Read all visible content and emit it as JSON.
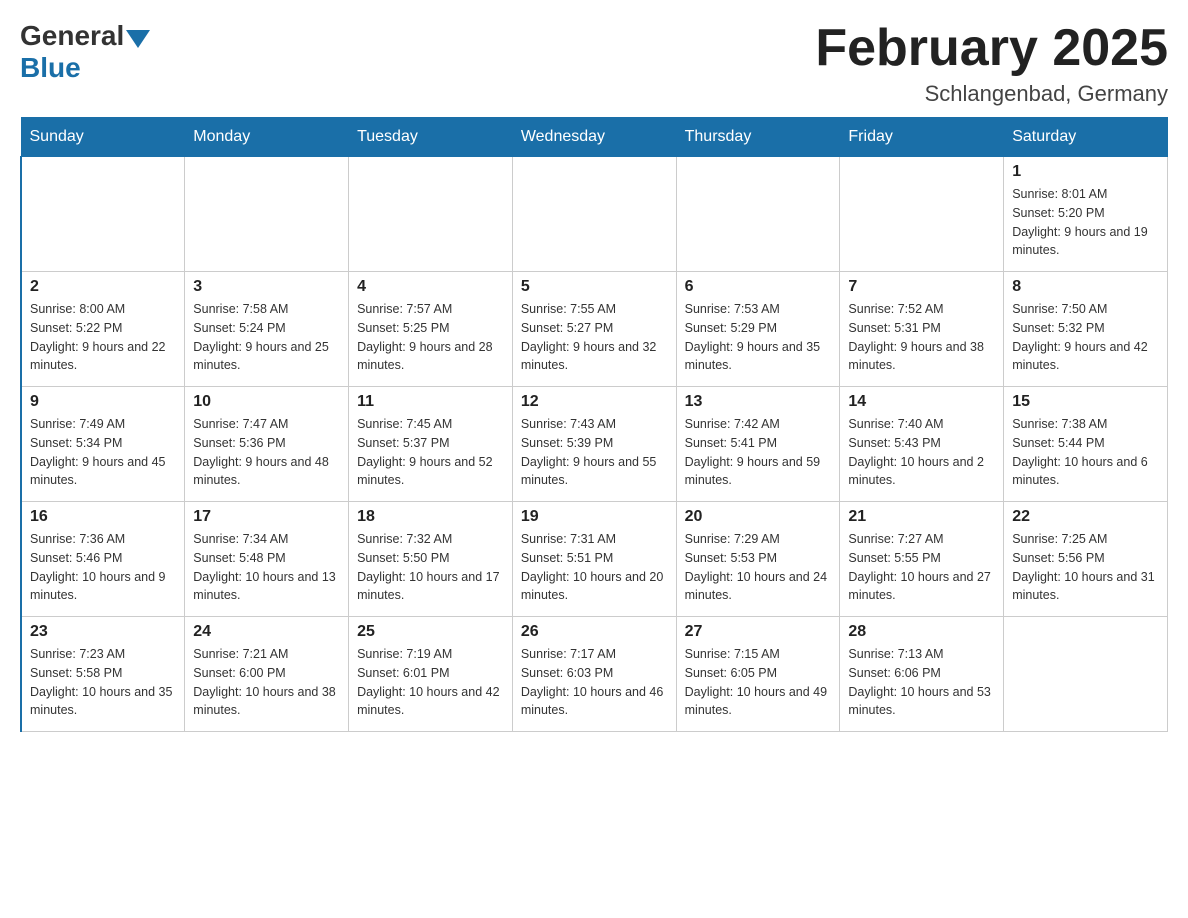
{
  "header": {
    "logo_general": "General",
    "logo_blue": "Blue",
    "title": "February 2025",
    "location": "Schlangenbad, Germany"
  },
  "days_of_week": [
    "Sunday",
    "Monday",
    "Tuesday",
    "Wednesday",
    "Thursday",
    "Friday",
    "Saturday"
  ],
  "weeks": [
    {
      "days": [
        {
          "num": "",
          "info": ""
        },
        {
          "num": "",
          "info": ""
        },
        {
          "num": "",
          "info": ""
        },
        {
          "num": "",
          "info": ""
        },
        {
          "num": "",
          "info": ""
        },
        {
          "num": "",
          "info": ""
        },
        {
          "num": "1",
          "info": "Sunrise: 8:01 AM\nSunset: 5:20 PM\nDaylight: 9 hours and 19 minutes."
        }
      ]
    },
    {
      "days": [
        {
          "num": "2",
          "info": "Sunrise: 8:00 AM\nSunset: 5:22 PM\nDaylight: 9 hours and 22 minutes."
        },
        {
          "num": "3",
          "info": "Sunrise: 7:58 AM\nSunset: 5:24 PM\nDaylight: 9 hours and 25 minutes."
        },
        {
          "num": "4",
          "info": "Sunrise: 7:57 AM\nSunset: 5:25 PM\nDaylight: 9 hours and 28 minutes."
        },
        {
          "num": "5",
          "info": "Sunrise: 7:55 AM\nSunset: 5:27 PM\nDaylight: 9 hours and 32 minutes."
        },
        {
          "num": "6",
          "info": "Sunrise: 7:53 AM\nSunset: 5:29 PM\nDaylight: 9 hours and 35 minutes."
        },
        {
          "num": "7",
          "info": "Sunrise: 7:52 AM\nSunset: 5:31 PM\nDaylight: 9 hours and 38 minutes."
        },
        {
          "num": "8",
          "info": "Sunrise: 7:50 AM\nSunset: 5:32 PM\nDaylight: 9 hours and 42 minutes."
        }
      ]
    },
    {
      "days": [
        {
          "num": "9",
          "info": "Sunrise: 7:49 AM\nSunset: 5:34 PM\nDaylight: 9 hours and 45 minutes."
        },
        {
          "num": "10",
          "info": "Sunrise: 7:47 AM\nSunset: 5:36 PM\nDaylight: 9 hours and 48 minutes."
        },
        {
          "num": "11",
          "info": "Sunrise: 7:45 AM\nSunset: 5:37 PM\nDaylight: 9 hours and 52 minutes."
        },
        {
          "num": "12",
          "info": "Sunrise: 7:43 AM\nSunset: 5:39 PM\nDaylight: 9 hours and 55 minutes."
        },
        {
          "num": "13",
          "info": "Sunrise: 7:42 AM\nSunset: 5:41 PM\nDaylight: 9 hours and 59 minutes."
        },
        {
          "num": "14",
          "info": "Sunrise: 7:40 AM\nSunset: 5:43 PM\nDaylight: 10 hours and 2 minutes."
        },
        {
          "num": "15",
          "info": "Sunrise: 7:38 AM\nSunset: 5:44 PM\nDaylight: 10 hours and 6 minutes."
        }
      ]
    },
    {
      "days": [
        {
          "num": "16",
          "info": "Sunrise: 7:36 AM\nSunset: 5:46 PM\nDaylight: 10 hours and 9 minutes."
        },
        {
          "num": "17",
          "info": "Sunrise: 7:34 AM\nSunset: 5:48 PM\nDaylight: 10 hours and 13 minutes."
        },
        {
          "num": "18",
          "info": "Sunrise: 7:32 AM\nSunset: 5:50 PM\nDaylight: 10 hours and 17 minutes."
        },
        {
          "num": "19",
          "info": "Sunrise: 7:31 AM\nSunset: 5:51 PM\nDaylight: 10 hours and 20 minutes."
        },
        {
          "num": "20",
          "info": "Sunrise: 7:29 AM\nSunset: 5:53 PM\nDaylight: 10 hours and 24 minutes."
        },
        {
          "num": "21",
          "info": "Sunrise: 7:27 AM\nSunset: 5:55 PM\nDaylight: 10 hours and 27 minutes."
        },
        {
          "num": "22",
          "info": "Sunrise: 7:25 AM\nSunset: 5:56 PM\nDaylight: 10 hours and 31 minutes."
        }
      ]
    },
    {
      "days": [
        {
          "num": "23",
          "info": "Sunrise: 7:23 AM\nSunset: 5:58 PM\nDaylight: 10 hours and 35 minutes."
        },
        {
          "num": "24",
          "info": "Sunrise: 7:21 AM\nSunset: 6:00 PM\nDaylight: 10 hours and 38 minutes."
        },
        {
          "num": "25",
          "info": "Sunrise: 7:19 AM\nSunset: 6:01 PM\nDaylight: 10 hours and 42 minutes."
        },
        {
          "num": "26",
          "info": "Sunrise: 7:17 AM\nSunset: 6:03 PM\nDaylight: 10 hours and 46 minutes."
        },
        {
          "num": "27",
          "info": "Sunrise: 7:15 AM\nSunset: 6:05 PM\nDaylight: 10 hours and 49 minutes."
        },
        {
          "num": "28",
          "info": "Sunrise: 7:13 AM\nSunset: 6:06 PM\nDaylight: 10 hours and 53 minutes."
        },
        {
          "num": "",
          "info": ""
        }
      ]
    }
  ]
}
